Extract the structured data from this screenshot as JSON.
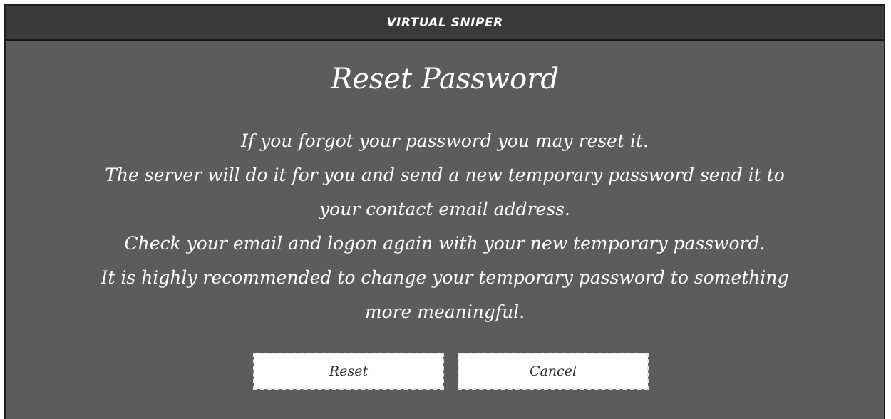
{
  "window": {
    "title": "VIRTUAL SNIPER"
  },
  "dialog": {
    "heading": "Reset Password",
    "message_lines": [
      "If you forgot your password you may reset it.",
      "The server will do it for you and send a new temporary password send it to",
      "your contact email address.",
      "Check your email and logon again with your new temporary password.",
      "It is highly recommended to change your temporary password to something",
      "more meaningful."
    ],
    "reset_label": "Reset",
    "cancel_label": "Cancel"
  },
  "colors": {
    "background": "#5c5c5c",
    "titlebar": "#3a3a3a",
    "text": "#ffffff",
    "button_bg": "#ffffff",
    "button_text": "#333333"
  }
}
